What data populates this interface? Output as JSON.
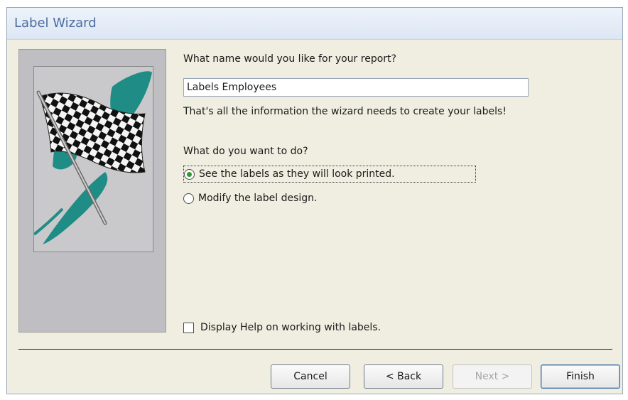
{
  "window": {
    "title": "Label Wizard"
  },
  "question": "What name would you like for your report?",
  "report_name": "Labels Employees",
  "info": "That's all the information the wizard needs to create your labels!",
  "todo_label": "What do you want to do?",
  "options": [
    {
      "label": "See the labels as they will look printed.",
      "selected": true
    },
    {
      "label": "Modify the label design.",
      "selected": false
    }
  ],
  "help_checkbox": {
    "label": "Display Help on working with labels.",
    "checked": false
  },
  "buttons": {
    "cancel": "Cancel",
    "back": "< Back",
    "next": "Next >",
    "finish": "Finish"
  },
  "colors": {
    "accent": "#2e9a2e",
    "title_text": "#4a6da0",
    "dialog_bg": "#f0eee1",
    "art_teal": "#1f8c86"
  },
  "icons": {
    "wizard_art": "checkered-flag-icon"
  }
}
